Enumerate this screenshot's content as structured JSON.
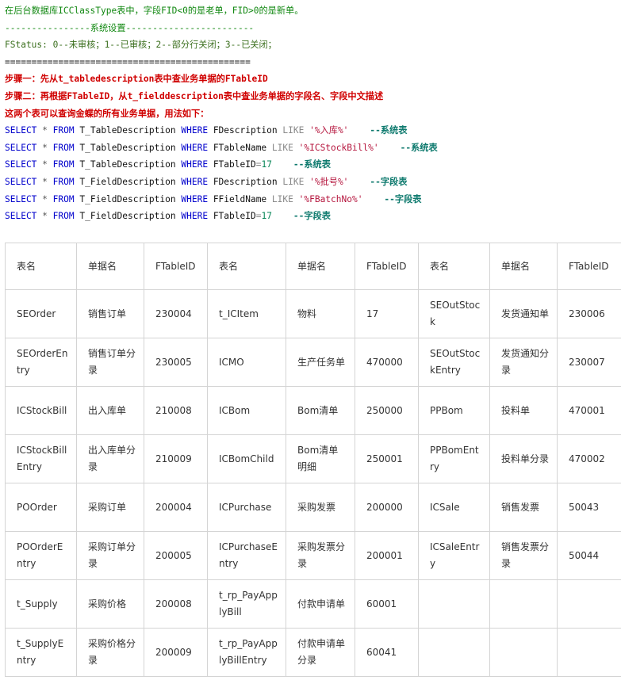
{
  "notes": {
    "line1": "在后台数据库ICClassType表中，字段FID<0的是老单，FID>0的是新单。",
    "line2": "----------------系统设置------------------------",
    "line3": "FStatus: 0--未审核；1--已审核；2--部分行关闭；3--已关闭；",
    "line4": "==============================================",
    "step1": "步骤一：先从t_tabledescription表中查业务单据的FTableID",
    "step2": "步骤二：再根据FTableID，从t_fielddescription表中查业务单据的字段名、字段中文描述",
    "step3": "这两个表可以查询金蝶的所有业务单据，用法如下："
  },
  "sql": [
    {
      "select": "SELECT",
      "star": "*",
      "from": "FROM",
      "table": "T_TableDescription",
      "where": "WHERE",
      "field": "FDescription",
      "op": "LIKE",
      "value": "'%入库%'",
      "comment": "--系统表"
    },
    {
      "select": "SELECT",
      "star": "*",
      "from": "FROM",
      "table": "T_TableDescription",
      "where": "WHERE",
      "field": "FTableName",
      "op": "LIKE",
      "value": "'%ICStockBill%'",
      "comment": "--系统表"
    },
    {
      "select": "SELECT",
      "star": "*",
      "from": "FROM",
      "table": "T_TableDescription",
      "where": "WHERE",
      "field": "FTableID",
      "op": "=",
      "value": "17",
      "comment": "--系统表"
    },
    {
      "select": "SELECT",
      "star": "*",
      "from": "FROM",
      "table": "T_FieldDescription",
      "where": "WHERE",
      "field": "FDescription",
      "op": "LIKE",
      "value": "'%批号%'",
      "comment": "--字段表"
    },
    {
      "select": "SELECT",
      "star": "*",
      "from": "FROM",
      "table": "T_FieldDescription",
      "where": "WHERE",
      "field": "FFieldName",
      "op": "LIKE",
      "value": "'%FBatchNo%'",
      "comment": "--字段表"
    },
    {
      "select": "SELECT",
      "star": "*",
      "from": "FROM",
      "table": "T_FieldDescription",
      "where": "WHERE",
      "field": "FTableID",
      "op": "=",
      "value": "17",
      "comment": "--字段表"
    }
  ],
  "table": {
    "headers": [
      "表名",
      "单据名",
      "FTableID",
      "表名",
      "单据名",
      "FTableID",
      "表名",
      "单据名",
      "FTableID"
    ],
    "rows": [
      [
        "SEOrder",
        "销售订单",
        "230004",
        "t_ICItem",
        "物料",
        "17",
        "SEOutStock",
        "发货通知单",
        "230006"
      ],
      [
        "SEOrderEntry",
        "销售订单分录",
        "230005",
        "ICMO",
        "生产任务单",
        "470000",
        "SEOutStockEntry",
        "发货通知分录",
        "230007"
      ],
      [
        "ICStockBill",
        "出入库单",
        "210008",
        "ICBom",
        "Bom清单",
        "250000",
        "PPBom",
        "投料单",
        "470001"
      ],
      [
        "ICStockBillEntry",
        "出入库单分录",
        "210009",
        "ICBomChild",
        "Bom清单明细",
        "250001",
        "PPBomEntry",
        "投料单分录",
        "470002"
      ],
      [
        "POOrder",
        "采购订单",
        "200004",
        "ICPurchase",
        "采购发票",
        "200000",
        "ICSale",
        "销售发票",
        "50043"
      ],
      [
        "POOrderEntry",
        "采购订单分录",
        "200005",
        "ICPurchaseEntry",
        "采购发票分录",
        "200001",
        "ICSaleEntry",
        "销售发票分录",
        "50044"
      ],
      [
        "t_Supply",
        "采购价格",
        "200008",
        "t_rp_PayApplyBill",
        "付款申请单",
        "60001",
        "",
        "",
        ""
      ],
      [
        "t_SupplyEntry",
        "采购价格分录",
        "200009",
        "t_rp_PayApplyBillEntry",
        "付款申请单分录",
        "60041",
        "",
        "",
        ""
      ]
    ]
  }
}
